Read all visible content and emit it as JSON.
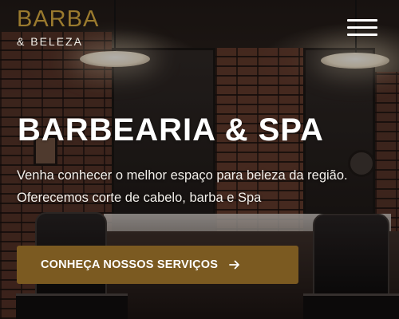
{
  "header": {
    "brand_name": "BARBA",
    "brand_sub": "& BELEZA",
    "menu_icon": "hamburger-menu-icon"
  },
  "hero": {
    "title": "BARBEARIA & SPA",
    "description": "Venha conhecer o melhor espaço para beleza da região. Oferecemos corte de cabelo, barba e Spa",
    "cta_label": "CONHEÇA NOSSOS SERVIÇOS",
    "cta_icon": "arrow-right-icon"
  },
  "colors": {
    "brand_gold": "#9a7a2e",
    "cta_background": "#7b5a21",
    "text_light": "#ffffff"
  }
}
